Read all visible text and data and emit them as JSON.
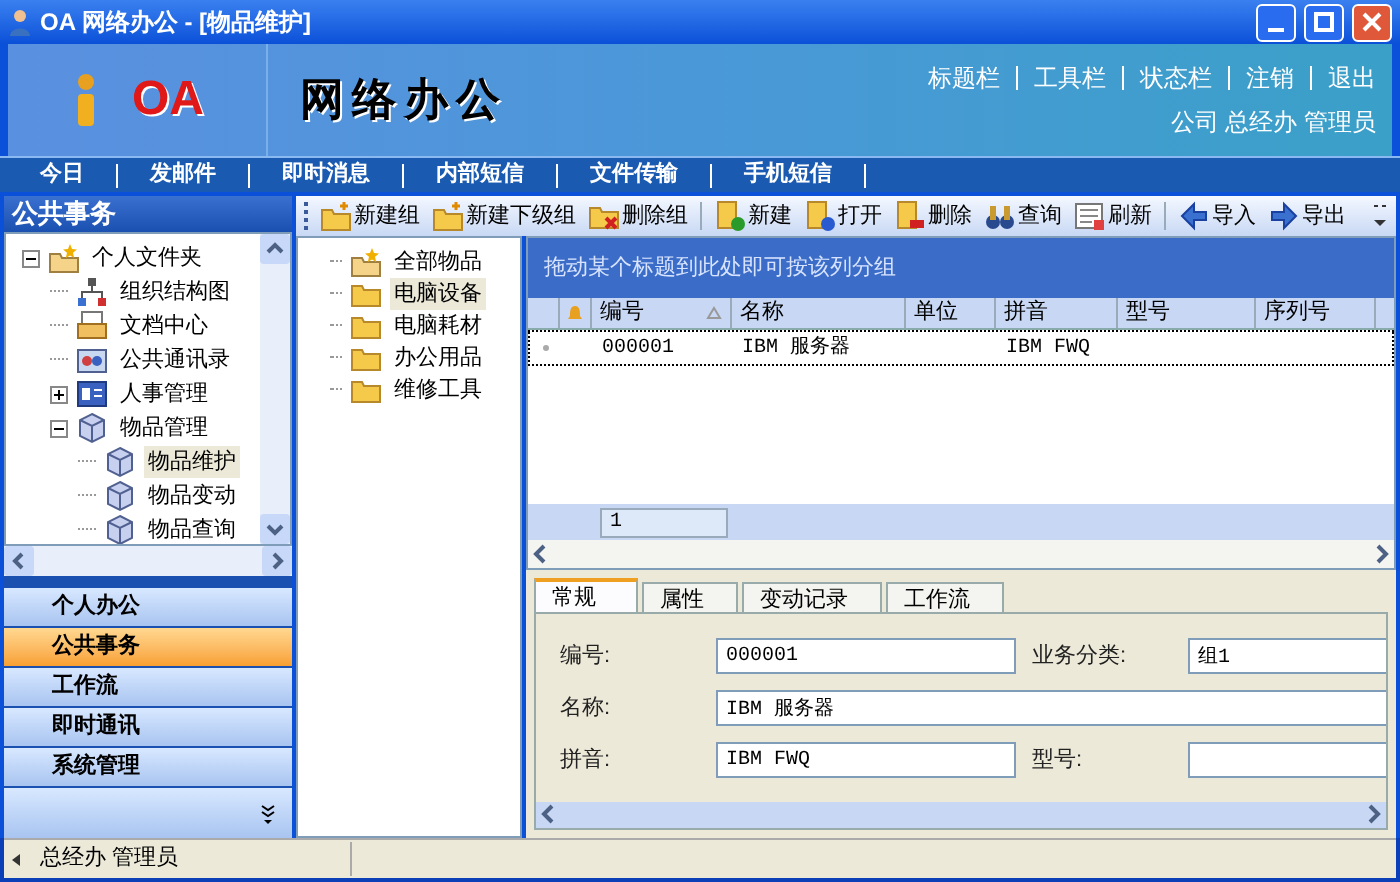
{
  "window": {
    "title": "OA 网络办公 - [物品维护]"
  },
  "banner": {
    "logo": "OA",
    "title": "网络办公",
    "links": [
      "标题栏",
      "工具栏",
      "状态栏",
      "注销",
      "退出"
    ],
    "user_info": "公司 总经办 管理员"
  },
  "nav": [
    "今日",
    "发邮件",
    "即时消息",
    "内部短信",
    "文件传输",
    "手机短信"
  ],
  "left_panel": {
    "title": "公共事务",
    "tree": [
      {
        "label": "个人文件夹",
        "expanded": true,
        "children": [
          {
            "label": "组织结构图"
          },
          {
            "label": "文档中心"
          },
          {
            "label": "公共通讯录"
          },
          {
            "label": "人事管理",
            "expanded": false
          },
          {
            "label": "物品管理",
            "expanded": true,
            "children": [
              {
                "label": "物品维护",
                "selected": true
              },
              {
                "label": "物品变动",
                "selected": false
              },
              {
                "label": "物品查询",
                "selected": false
              }
            ]
          }
        ]
      }
    ],
    "nav_buttons": [
      {
        "label": "个人办公",
        "selected": false
      },
      {
        "label": "公共事务",
        "selected": true
      },
      {
        "label": "工作流",
        "selected": false
      },
      {
        "label": "即时通讯",
        "selected": false
      },
      {
        "label": "系统管理",
        "selected": false
      }
    ]
  },
  "toolbar": [
    {
      "label": "新建组"
    },
    {
      "label": "新建下级组"
    },
    {
      "label": "删除组"
    },
    {
      "label": "新建"
    },
    {
      "label": "打开"
    },
    {
      "label": "删除"
    },
    {
      "label": "查询"
    },
    {
      "label": "刷新"
    },
    {
      "label": "导入"
    },
    {
      "label": "导出"
    }
  ],
  "group_tree": [
    {
      "label": "全部物品",
      "kind": "all",
      "selected": false
    },
    {
      "label": "电脑设备",
      "kind": "folder",
      "selected": true
    },
    {
      "label": "电脑耗材",
      "kind": "folder",
      "selected": false
    },
    {
      "label": "办公用品",
      "kind": "folder",
      "selected": false
    },
    {
      "label": "维修工具",
      "kind": "folder",
      "selected": false
    }
  ],
  "grid": {
    "group_hint": "拖动某个标题到此处即可按该列分组",
    "columns": [
      {
        "label": "编号",
        "sorted": true
      },
      {
        "label": "名称",
        "sorted": false
      },
      {
        "label": "单位",
        "sorted": false
      },
      {
        "label": "拼音",
        "sorted": false
      },
      {
        "label": "型号",
        "sorted": false
      },
      {
        "label": "序列号",
        "sorted": false
      }
    ],
    "rows": [
      {
        "focused": true,
        "cells": [
          "000001",
          "IBM 服务器",
          null,
          "IBM FWQ",
          null,
          null
        ]
      }
    ],
    "footer": "1"
  },
  "tabs": [
    {
      "label": "常规",
      "selected": true
    },
    {
      "label": "属性",
      "selected": false
    },
    {
      "label": "变动记录",
      "selected": false
    },
    {
      "label": "工作流",
      "selected": false
    }
  ],
  "form": [
    {
      "label": "编号:",
      "value": "000001",
      "kind": "half"
    },
    {
      "label": "业务分类:",
      "value": "组1",
      "kind": "half"
    },
    {
      "label": "名称:",
      "value": "IBM 服务器",
      "kind": "wide"
    },
    {
      "label": "拼音:",
      "value": "IBM FWQ",
      "kind": "half"
    },
    {
      "label": "型号:",
      "kind": "half"
    }
  ],
  "status_bar": {
    "text": "总经办 管理员"
  }
}
